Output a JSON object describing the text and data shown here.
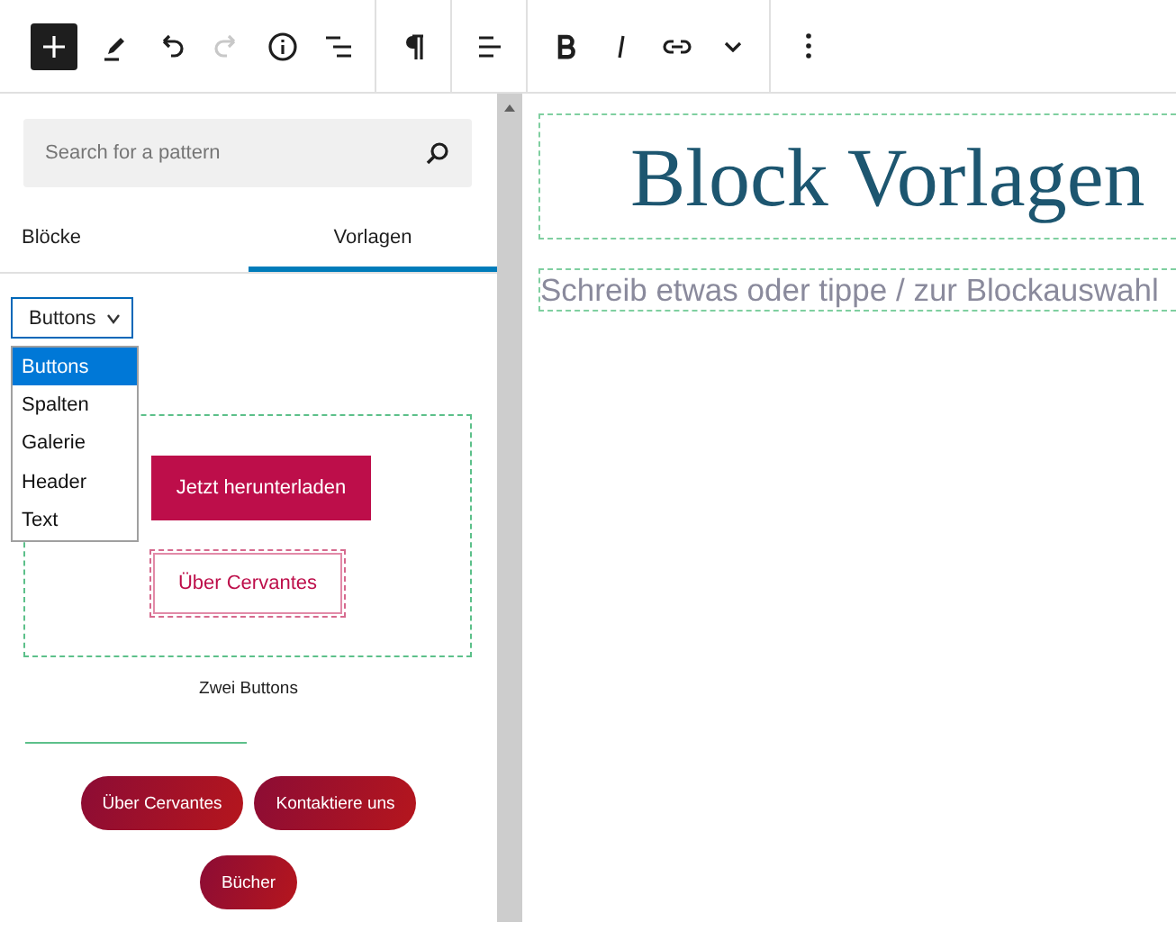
{
  "toolbar": [
    {
      "kind": "add"
    },
    {
      "kind": "pen"
    },
    {
      "kind": "undo",
      "disabled": false
    },
    {
      "kind": "redo",
      "disabled": true
    },
    {
      "kind": "info"
    },
    {
      "kind": "outline"
    },
    {
      "kind": "separator"
    },
    {
      "kind": "paragraph"
    },
    {
      "kind": "separator"
    },
    {
      "kind": "align"
    },
    {
      "kind": "separator"
    },
    {
      "kind": "bold"
    },
    {
      "kind": "italic"
    },
    {
      "kind": "link"
    },
    {
      "kind": "chevron"
    },
    {
      "kind": "separator"
    },
    {
      "kind": "more"
    }
  ],
  "search": {
    "placeholder": "Search for a pattern"
  },
  "tabs": [
    {
      "label": "Blöcke",
      "selected": false
    },
    {
      "label": "Vorlagen",
      "selected": true
    }
  ],
  "category": {
    "value": "Buttons",
    "options": [
      {
        "label": "Buttons",
        "selected": true
      },
      {
        "label": "Spalten",
        "selected": false
      },
      {
        "label": "Galerie",
        "selected": false
      },
      {
        "label": "Header",
        "selected": false
      },
      {
        "label": "Text",
        "selected": false
      }
    ]
  },
  "patterns": [
    {
      "buttons": [
        {
          "label": "Jetzt herunterladen",
          "kind": "filled"
        },
        {
          "label": "Über Cervantes",
          "kind": "outline"
        }
      ],
      "caption": "Zwei Buttons"
    },
    {
      "buttons": [
        {
          "label": "Über Cervantes",
          "kind": "pill"
        },
        {
          "label": "Kontaktiere uns",
          "kind": "pill"
        },
        {
          "label": "Bücher",
          "kind": "pill"
        }
      ]
    }
  ],
  "editor": {
    "heading": "Block Vorlagen",
    "paragraph_placeholder": "Schreib etwas oder tippe / zur Blockauswahl"
  }
}
